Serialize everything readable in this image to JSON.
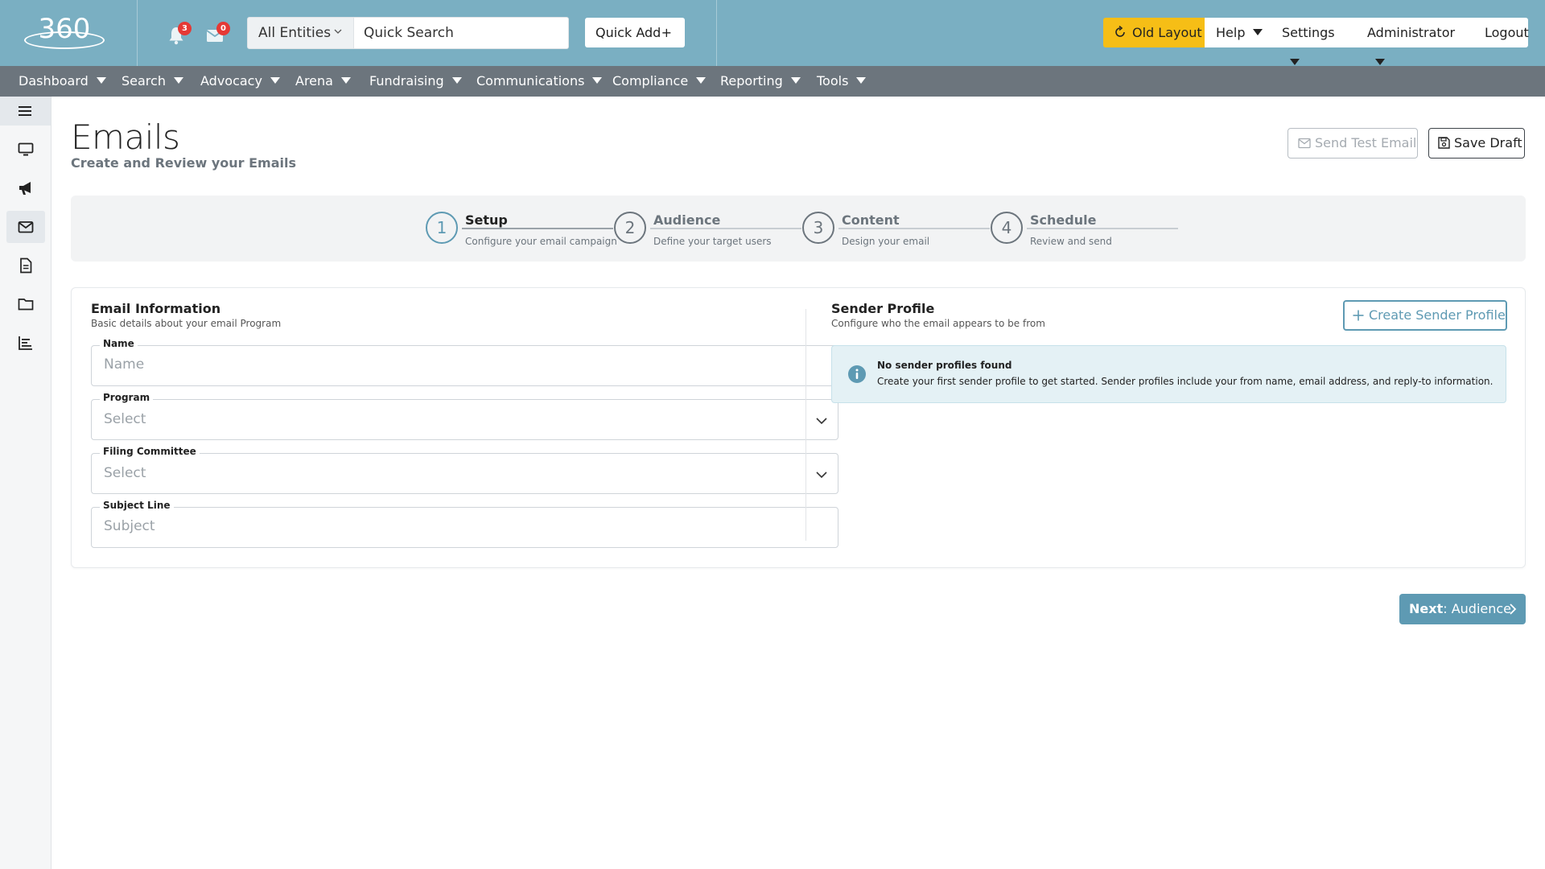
{
  "header": {
    "logo_text": "360",
    "notifications_count": "3",
    "messages_count": "0",
    "entity_select": "All Entities",
    "quick_search_label": "Quick Search",
    "quick_add_label": "Quick Add",
    "quick_add_symbol": "+",
    "old_layout_label": "Old Layout",
    "help_label": "Help",
    "settings_label": "Settings",
    "user_label": "Administrator",
    "logout_label": "Logout"
  },
  "menu": [
    {
      "label": "Dashboard"
    },
    {
      "label": "Search"
    },
    {
      "label": "Advocacy"
    },
    {
      "label": "Arena"
    },
    {
      "label": "Fundraising"
    },
    {
      "label": "Communications"
    },
    {
      "label": "Compliance"
    },
    {
      "label": "Reporting"
    },
    {
      "label": "Tools"
    }
  ],
  "sidebar": {
    "icons": [
      "menu-icon",
      "monitor-icon",
      "megaphone-icon",
      "envelope-icon",
      "document-icon",
      "folder-icon",
      "bar-list-icon"
    ],
    "active": "envelope-icon"
  },
  "page": {
    "title": "Emails",
    "subtitle": "Create and Review your Emails",
    "send_test_label": "Send Test Email",
    "save_draft_label": "Save Draft"
  },
  "steps": [
    {
      "number": "1",
      "title": "Setup",
      "description": "Configure your email campaign",
      "active": true
    },
    {
      "number": "2",
      "title": "Audience",
      "description": "Define your target users",
      "active": false
    },
    {
      "number": "3",
      "title": "Content",
      "description": "Design your email",
      "active": false
    },
    {
      "number": "4",
      "title": "Schedule",
      "description": "Review and send",
      "active": false
    }
  ],
  "email_info": {
    "title": "Email Information",
    "description": "Basic details about your email Program",
    "fields": {
      "name": {
        "label": "Name",
        "placeholder": "Name",
        "value": ""
      },
      "program": {
        "label": "Program",
        "value": "Select"
      },
      "filing_committee": {
        "label": "Filing Committee",
        "value": "Select"
      },
      "subject": {
        "label": "Subject Line",
        "placeholder": "Subject",
        "value": ""
      }
    }
  },
  "sender_profile": {
    "title": "Sender Profile",
    "description": "Configure who the email appears to be from",
    "create_label": "Create Sender Profile",
    "alert_title": "No sender profiles found",
    "alert_text": "Create your first sender profile to get started. Sender profiles include your from name, email address, and reply-to information."
  },
  "next_button": {
    "prefix": "Next",
    "target": ": Audience"
  },
  "colors": {
    "topbar": "#7aafc2",
    "menubar": "#6c757d",
    "accent": "#5e9ab3",
    "old_layout": "#f6be16",
    "badge": "#e53935",
    "alert_bg": "#e4f1f5"
  }
}
